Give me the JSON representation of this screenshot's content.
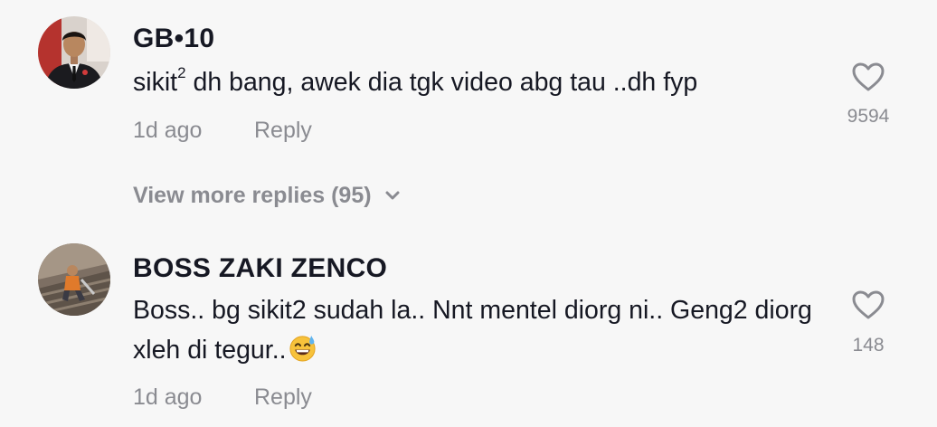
{
  "comments": [
    {
      "username": "GB•10",
      "text_before_sup": "sikit",
      "text_sup": "2",
      "text_after_sup": " dh bang, awek dia tgk video abg tau ..dh fyp",
      "time": "1d ago",
      "reply_label": "Reply",
      "likes": "9594",
      "view_more_label": "View more replies (95)",
      "avatar_icon": "avatar-man-in-suit",
      "heart_icon": "heart-outline-icon"
    },
    {
      "username": "BOSS ZAKI ZENCO",
      "text": "Boss.. bg sikit2 sudah la.. Nnt mentel diorg ni.. Geng2 diorg xleh di tegur..",
      "emoji": "grinning-face-with-sweat-emoji",
      "time": "1d ago",
      "reply_label": "Reply",
      "likes": "148",
      "avatar_icon": "avatar-worker-on-roof",
      "heart_icon": "heart-outline-icon"
    }
  ],
  "colors": {
    "background": "#f7f7f7",
    "text_primary": "#161823",
    "text_secondary": "#8a8b91"
  }
}
